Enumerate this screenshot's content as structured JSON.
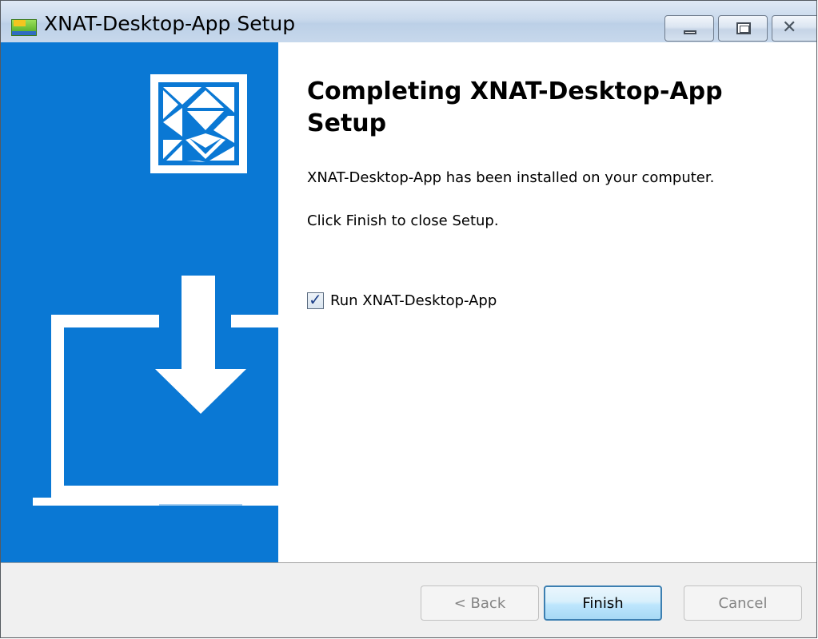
{
  "window": {
    "title": "XNAT-Desktop-App Setup",
    "app_icon": "xnat-app-icon",
    "controls": {
      "minimize_icon": "minimize-icon",
      "maximize_icon": "maximize-icon",
      "close_icon": "close-icon"
    }
  },
  "banner": {
    "logo_icon": "xnat-logo-icon",
    "illustration_icon": "laptop-download-icon",
    "color": "#0a78d4"
  },
  "content": {
    "heading": "Completing XNAT-Desktop-App Setup",
    "installed_message": "XNAT-Desktop-App has been installed on your computer.",
    "finish_instruction": "Click Finish to close Setup.",
    "run_checkbox": {
      "label": "Run XNAT-Desktop-App",
      "checked": true
    }
  },
  "footer": {
    "back_label": "< Back",
    "back_enabled": false,
    "finish_label": "Finish",
    "cancel_label": "Cancel",
    "cancel_enabled": false
  }
}
